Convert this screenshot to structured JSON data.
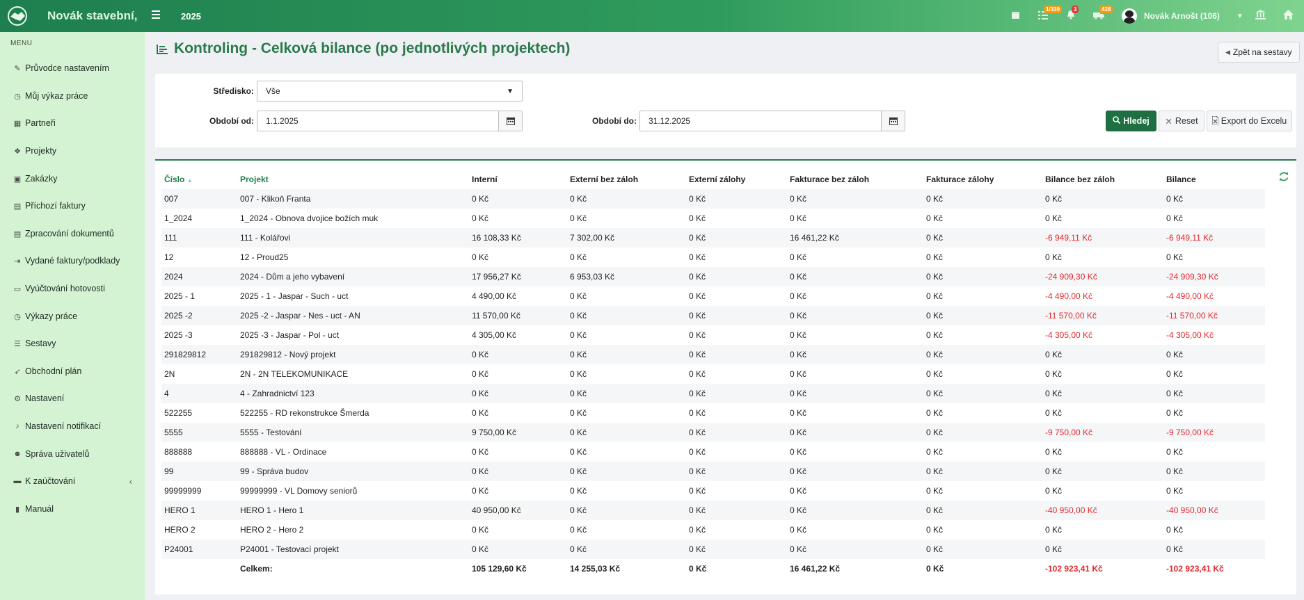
{
  "topbar": {
    "brand": "Novák stavební,",
    "year": "2025",
    "badges": {
      "tasks": "1/339",
      "notifications": "3",
      "shipments": "428"
    },
    "user": "Novák Arnošt (106)",
    "icons": [
      "calendar-icon",
      "tasks-icon",
      "bell-icon",
      "truck-icon",
      "bank-icon",
      "home-icon"
    ],
    "colors": {
      "brand_dark": "#1e7e4f",
      "brand_light": "#7fd48f",
      "badge_orange": "#f39c12",
      "badge_red": "#e53935"
    }
  },
  "sidebar": {
    "menu_label": "MENU",
    "items": [
      {
        "label": "Průvodce nastavením",
        "icon": "pencil-icon"
      },
      {
        "label": "Můj výkaz práce",
        "icon": "clock-icon"
      },
      {
        "label": "Partneři",
        "icon": "building-icon"
      },
      {
        "label": "Projekty",
        "icon": "cubes-icon"
      },
      {
        "label": "Zakázky",
        "icon": "box-icon"
      },
      {
        "label": "Příchozí faktury",
        "icon": "document-icon"
      },
      {
        "label": "Zpracování dokumentů",
        "icon": "document-icon"
      },
      {
        "label": "Vydané faktury/podklady",
        "icon": "file-export-icon"
      },
      {
        "label": "Vyúčtování hotovosti",
        "icon": "money-icon"
      },
      {
        "label": "Výkazy práce",
        "icon": "clock-icon"
      },
      {
        "label": "Sestavy",
        "icon": "list-icon"
      },
      {
        "label": "Obchodní plán",
        "icon": "rocket-icon"
      },
      {
        "label": "Nastavení",
        "icon": "gears-icon"
      },
      {
        "label": "Nastavení notifikací",
        "icon": "bell-icon"
      },
      {
        "label": "Správa uživatelů",
        "icon": "users-icon"
      },
      {
        "label": "K zaúčtování",
        "icon": "folder-icon"
      },
      {
        "label": "Manuál",
        "icon": "book-icon"
      }
    ]
  },
  "page": {
    "title": "Kontroling - Celková bilance (po jednotlivých projektech)",
    "back_label": "Zpět na sestavy"
  },
  "filter": {
    "stredisko_label": "Středisko:",
    "stredisko_value": "Vše",
    "od_label": "Období od:",
    "od_value": "1.1.2025",
    "do_label": "Období do:",
    "do_value": "31.12.2025",
    "search_label": "Hledej",
    "reset_label": "Reset",
    "export_label": "Export do Excelu"
  },
  "table": {
    "headers": [
      "Číslo",
      "Projekt",
      "Interní",
      "Externí bez záloh",
      "Externí zálohy",
      "Fakturace bez záloh",
      "Fakturace zálohy",
      "Bilance bez záloh",
      "Bilance"
    ],
    "rows": [
      [
        "007",
        "007 - Klikoň Franta",
        "0 Kč",
        "0 Kč",
        "0 Kč",
        "0 Kč",
        "0 Kč",
        "0 Kč",
        "0 Kč"
      ],
      [
        "1_2024",
        "1_2024 - Obnova dvojice božích muk",
        "0 Kč",
        "0 Kč",
        "0 Kč",
        "0 Kč",
        "0 Kč",
        "0 Kč",
        "0 Kč"
      ],
      [
        "111",
        "111 - Kolářovi",
        "16 108,33 Kč",
        "7 302,00 Kč",
        "0 Kč",
        "16 461,22 Kč",
        "0 Kč",
        "-6 949,11 Kč",
        "-6 949,11 Kč"
      ],
      [
        "12",
        "12 - Proud25",
        "0 Kč",
        "0 Kč",
        "0 Kč",
        "0 Kč",
        "0 Kč",
        "0 Kč",
        "0 Kč"
      ],
      [
        "2024",
        "2024 - Dům a jeho vybavení",
        "17 956,27 Kč",
        "6 953,03 Kč",
        "0 Kč",
        "0 Kč",
        "0 Kč",
        "-24 909,30 Kč",
        "-24 909,30 Kč"
      ],
      [
        "2025 - 1",
        "2025 - 1 - Jaspar - Such - uct",
        "4 490,00 Kč",
        "0 Kč",
        "0 Kč",
        "0 Kč",
        "0 Kč",
        "-4 490,00 Kč",
        "-4 490,00 Kč"
      ],
      [
        "2025 -2",
        "2025 -2 - Jaspar - Nes - uct - AN",
        "11 570,00 Kč",
        "0 Kč",
        "0 Kč",
        "0 Kč",
        "0 Kč",
        "-11 570,00 Kč",
        "-11 570,00 Kč"
      ],
      [
        "2025 -3",
        "2025 -3 - Jaspar - Pol - uct",
        "4 305,00 Kč",
        "0 Kč",
        "0 Kč",
        "0 Kč",
        "0 Kč",
        "-4 305,00 Kč",
        "-4 305,00 Kč"
      ],
      [
        "291829812",
        "291829812 - Nový projekt",
        "0 Kč",
        "0 Kč",
        "0 Kč",
        "0 Kč",
        "0 Kč",
        "0 Kč",
        "0 Kč"
      ],
      [
        "2N",
        "2N - 2N TELEKOMUNIKACE",
        "0 Kč",
        "0 Kč",
        "0 Kč",
        "0 Kč",
        "0 Kč",
        "0 Kč",
        "0 Kč"
      ],
      [
        "4",
        "4 - Zahradnictví 123",
        "0 Kč",
        "0 Kč",
        "0 Kč",
        "0 Kč",
        "0 Kč",
        "0 Kč",
        "0 Kč"
      ],
      [
        "522255",
        "522255 - RD rekonstrukce Šmerda",
        "0 Kč",
        "0 Kč",
        "0 Kč",
        "0 Kč",
        "0 Kč",
        "0 Kč",
        "0 Kč"
      ],
      [
        "5555",
        "5555 - Testování",
        "9 750,00 Kč",
        "0 Kč",
        "0 Kč",
        "0 Kč",
        "0 Kč",
        "-9 750,00 Kč",
        "-9 750,00 Kč"
      ],
      [
        "888888",
        "888888 - VL - Ordinace",
        "0 Kč",
        "0 Kč",
        "0 Kč",
        "0 Kč",
        "0 Kč",
        "0 Kč",
        "0 Kč"
      ],
      [
        "99",
        "99 - Správa budov",
        "0 Kč",
        "0 Kč",
        "0 Kč",
        "0 Kč",
        "0 Kč",
        "0 Kč",
        "0 Kč"
      ],
      [
        "99999999",
        "99999999 - VL Domovy seniorů",
        "0 Kč",
        "0 Kč",
        "0 Kč",
        "0 Kč",
        "0 Kč",
        "0 Kč",
        "0 Kč"
      ],
      [
        "HERO 1",
        "HERO 1 - Hero 1",
        "40 950,00 Kč",
        "0 Kč",
        "0 Kč",
        "0 Kč",
        "0 Kč",
        "-40 950,00 Kč",
        "-40 950,00 Kč"
      ],
      [
        "HERO 2",
        "HERO 2 - Hero 2",
        "0 Kč",
        "0 Kč",
        "0 Kč",
        "0 Kč",
        "0 Kč",
        "0 Kč",
        "0 Kč"
      ],
      [
        "P24001",
        "P24001 - Testovací projekt",
        "0 Kč",
        "0 Kč",
        "0 Kč",
        "0 Kč",
        "0 Kč",
        "0 Kč",
        "0 Kč"
      ]
    ],
    "total": [
      "",
      "Celkem:",
      "105 129,60 Kč",
      "14 255,03 Kč",
      "0 Kč",
      "16 461,22 Kč",
      "0 Kč",
      "-102 923,41 Kč",
      "-102 923,41 Kč"
    ],
    "colors": {
      "negative": "#e3262b",
      "accent": "#1e7e4f"
    }
  }
}
